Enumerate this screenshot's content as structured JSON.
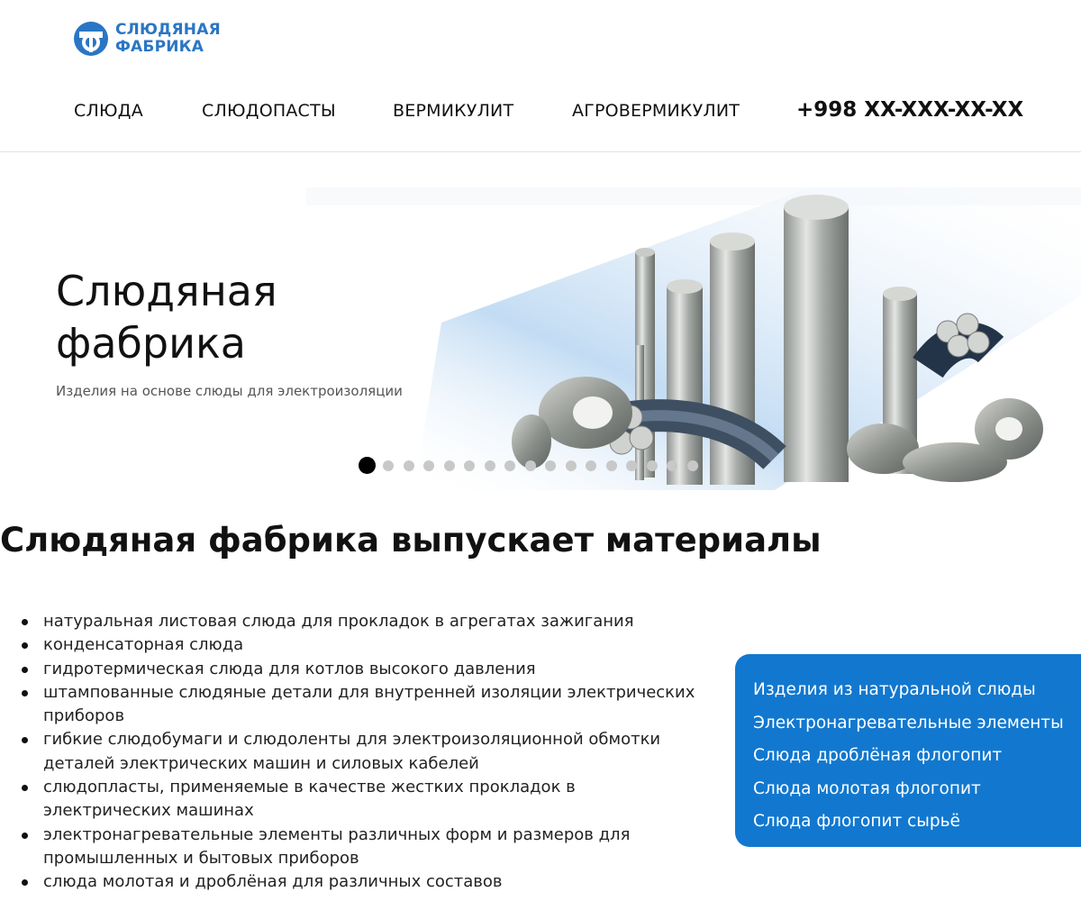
{
  "brand": {
    "line1": "СЛЮДЯНАЯ",
    "line2": "ФАБРИКА",
    "color": "#2a76c4"
  },
  "nav": {
    "items": [
      {
        "label": "СЛЮДА"
      },
      {
        "label": "СЛЮДОПАСТЫ"
      },
      {
        "label": "ВЕРМИКУЛИТ"
      },
      {
        "label": "АГРОВЕРМИКУЛИТ"
      }
    ],
    "phone": "+998 XX-XXX-XX-XX"
  },
  "hero": {
    "title_line1": "Слюдяная",
    "title_line2": "фабрика",
    "subtitle": "Изделия на основе слюды для электроизоляции",
    "slide_count": 17,
    "active_slide": 1
  },
  "main": {
    "heading": "Слюдяная фабрика выпускает материалы",
    "features": [
      "натуральная листовая слюда для прокладок в агрегатах зажигания",
      "конденсаторная слюда",
      "гидротермическая слюда для котлов высокого давления",
      "штампованные слюдяные детали для внутренней изоляции электрических приборов",
      "гибкие слюдобумаги и слюдоленты для электроизоляционной обмотки деталей электрических машин и силовых кабелей",
      "слюдопласты, применяемые в качестве жестких прокладок в электрических машинах",
      "электронагревательные элементы различных форм и размеров для промышленных и бытовых приборов",
      "слюда молотая и дроблёная для различных составов"
    ]
  },
  "sidebar": {
    "links": [
      "Изделия из натуральной слюды",
      "Электронагревательные элементы",
      "Слюда дроблёная флогопит",
      "Слюда молотая флогопит",
      "Слюда флогопит сырьё"
    ],
    "background": "#1278cf"
  }
}
